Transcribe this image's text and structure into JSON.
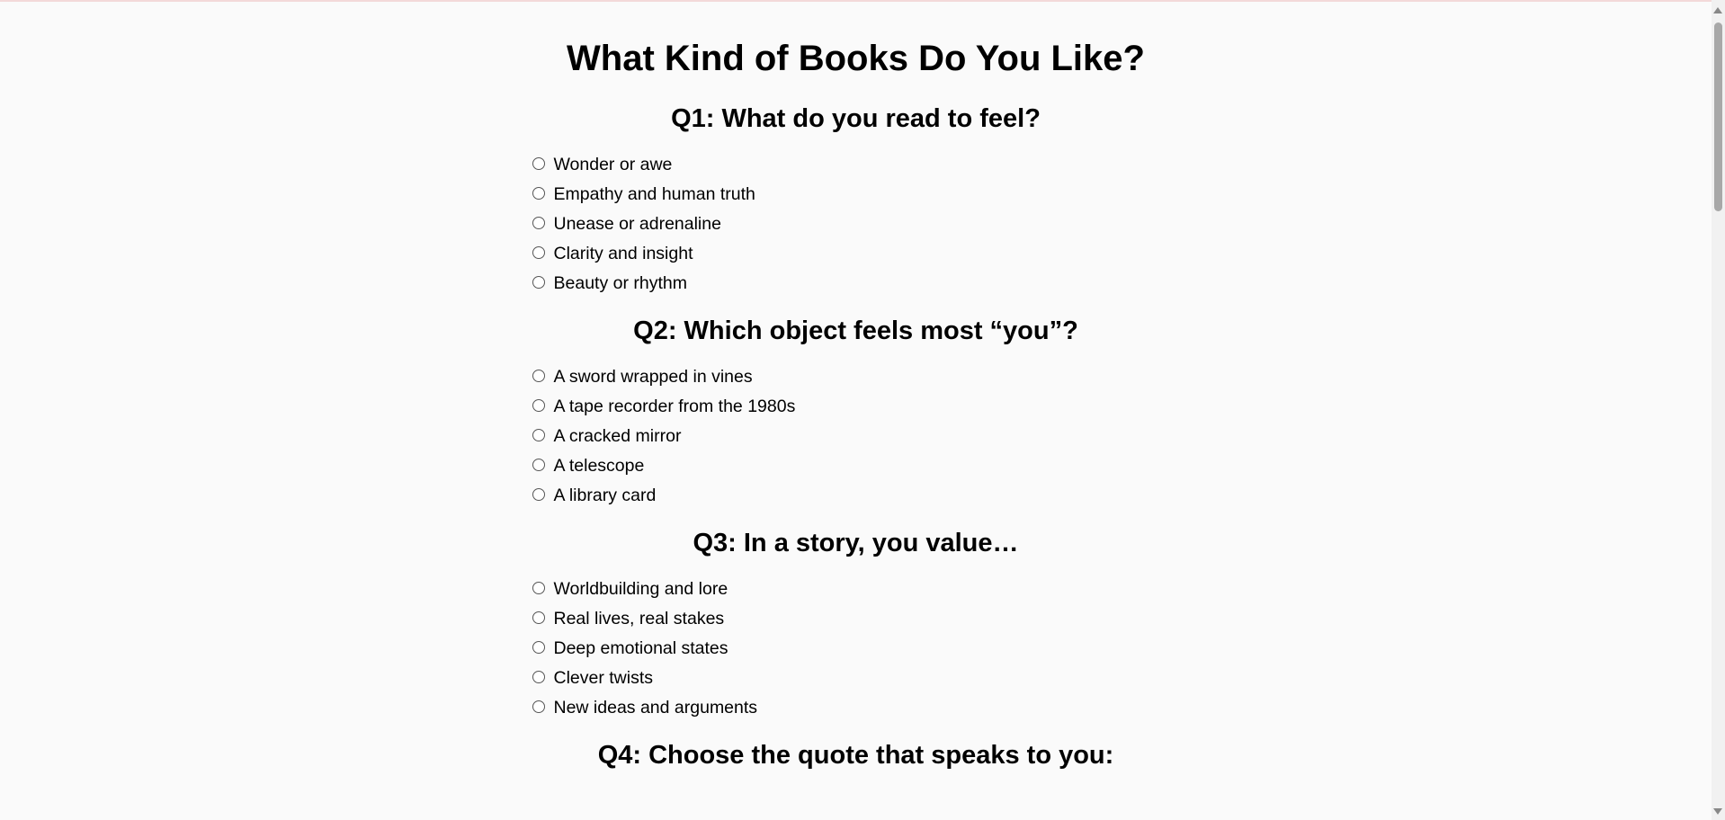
{
  "page": {
    "title": "What Kind of Books Do You Like?"
  },
  "questions": [
    {
      "title": "Q1: What do you read to feel?",
      "options": [
        "Wonder or awe",
        "Empathy and human truth",
        "Unease or adrenaline",
        "Clarity and insight",
        "Beauty or rhythm"
      ]
    },
    {
      "title": "Q2: Which object feels most “you”?",
      "options": [
        "A sword wrapped in vines",
        "A tape recorder from the 1980s",
        "A cracked mirror",
        "A telescope",
        "A library card"
      ]
    },
    {
      "title": "Q3: In a story, you value…",
      "options": [
        "Worldbuilding and lore",
        "Real lives, real stakes",
        "Deep emotional states",
        "Clever twists",
        "New ideas and arguments"
      ]
    },
    {
      "title": "Q4: Choose the quote that speaks to you:",
      "options": []
    }
  ],
  "colors": {
    "background": "#fafafa",
    "text": "#000000",
    "scrollbar_thumb": "#a8a8a8"
  }
}
